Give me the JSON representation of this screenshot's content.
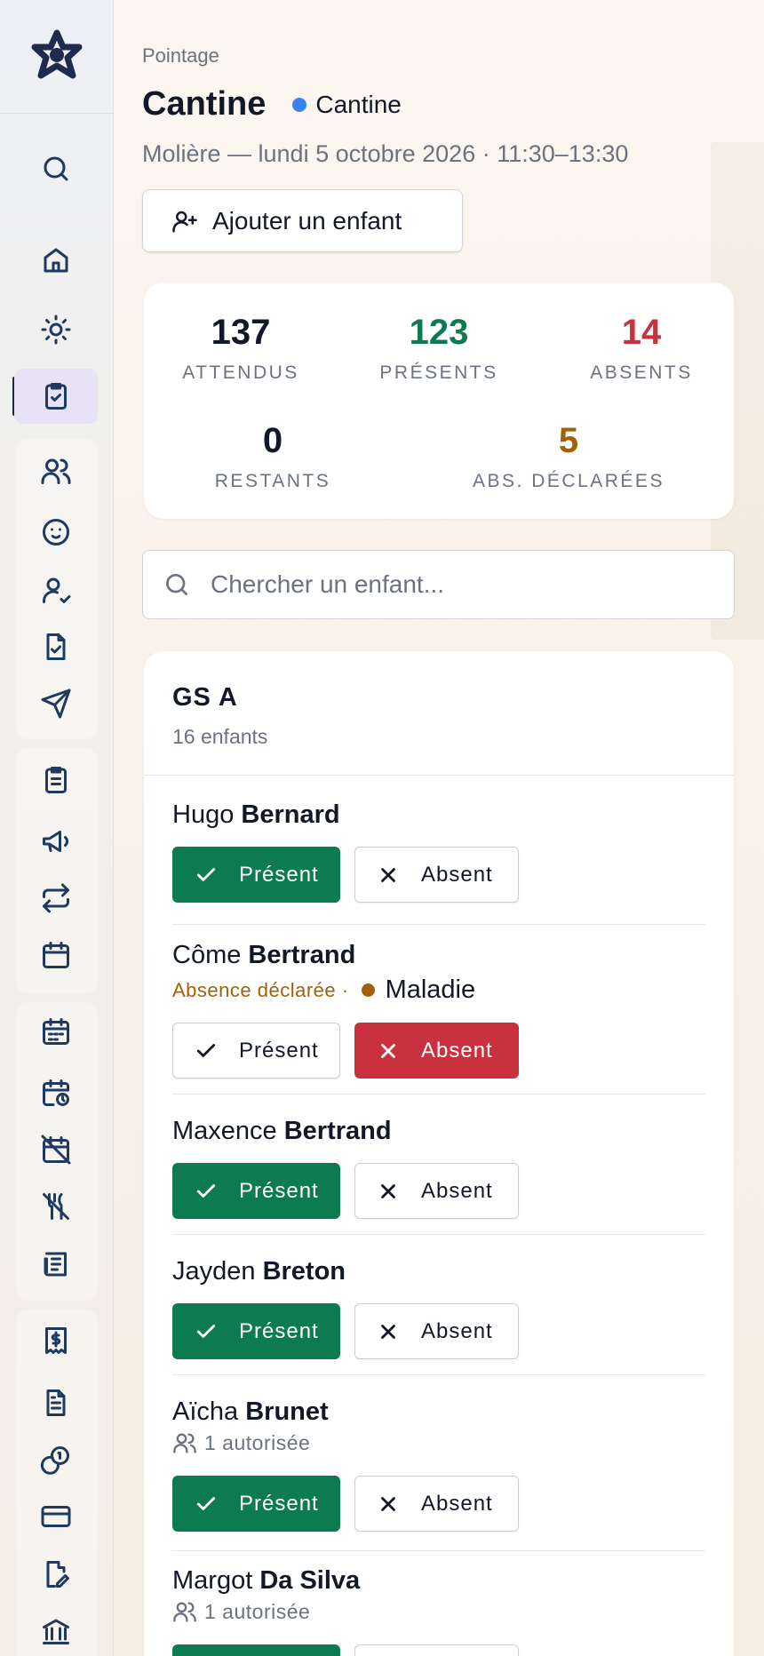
{
  "header": {
    "eyebrow": "Pointage",
    "title": "Cantine",
    "activity_chip": "Cantine",
    "subtitle": "Molière — lundi 5 octobre 2026 · 11:30–13:30",
    "add_child_label": "Ajouter un enfant"
  },
  "stats": {
    "expected": {
      "value": "137",
      "label": "ATTENDUS"
    },
    "present": {
      "value": "123",
      "label": "PRÉSENTS"
    },
    "absent": {
      "value": "14",
      "label": "ABSENTS"
    },
    "remaining": {
      "value": "0",
      "label": "RESTANTS"
    },
    "declared": {
      "value": "5",
      "label": "ABS. DÉCLARÉES"
    }
  },
  "search": {
    "placeholder": "Chercher un enfant..."
  },
  "group": {
    "name": "GS A",
    "count": "16 enfants",
    "children": [
      {
        "first": "Hugo",
        "last": "Bernard",
        "status": "present"
      },
      {
        "first": "Côme",
        "last": "Bertrand",
        "status": "absent",
        "declared": "Absence déclarée ·",
        "reason": "Maladie"
      },
      {
        "first": "Maxence",
        "last": "Bertrand",
        "status": "present"
      },
      {
        "first": "Jayden",
        "last": "Breton",
        "status": "present"
      },
      {
        "first": "Aïcha",
        "last": "Brunet",
        "status": "present",
        "authorized": "1 autorisée"
      },
      {
        "first": "Margot",
        "last": "Da Silva",
        "status": "present",
        "authorized": "1 autorisée"
      }
    ]
  },
  "buttons": {
    "present": "Présent",
    "absent": "Absent"
  },
  "colors": {
    "present": "#0d7a4f",
    "absent": "#c8313d",
    "declared": "#a16207",
    "chip_dot": "#3b82f6",
    "active_nav": "#e8e2f7"
  },
  "sidebar": {
    "active": "attendance-icon",
    "icons": [
      "search-icon",
      "home-icon",
      "sun-icon",
      "attendance-icon",
      "users-icon",
      "baby-icon",
      "user-check-icon",
      "file-check-icon",
      "send-icon",
      "clipboard-list-icon",
      "megaphone-icon",
      "repeat-icon",
      "calendar-icon",
      "calendar-days-icon",
      "calendar-clock-icon",
      "calendar-off-icon",
      "utensils-off-icon",
      "newspaper-icon",
      "receipt-icon",
      "file-text-icon",
      "coins-icon",
      "credit-card-icon",
      "file-edit-icon",
      "bank-icon"
    ]
  }
}
